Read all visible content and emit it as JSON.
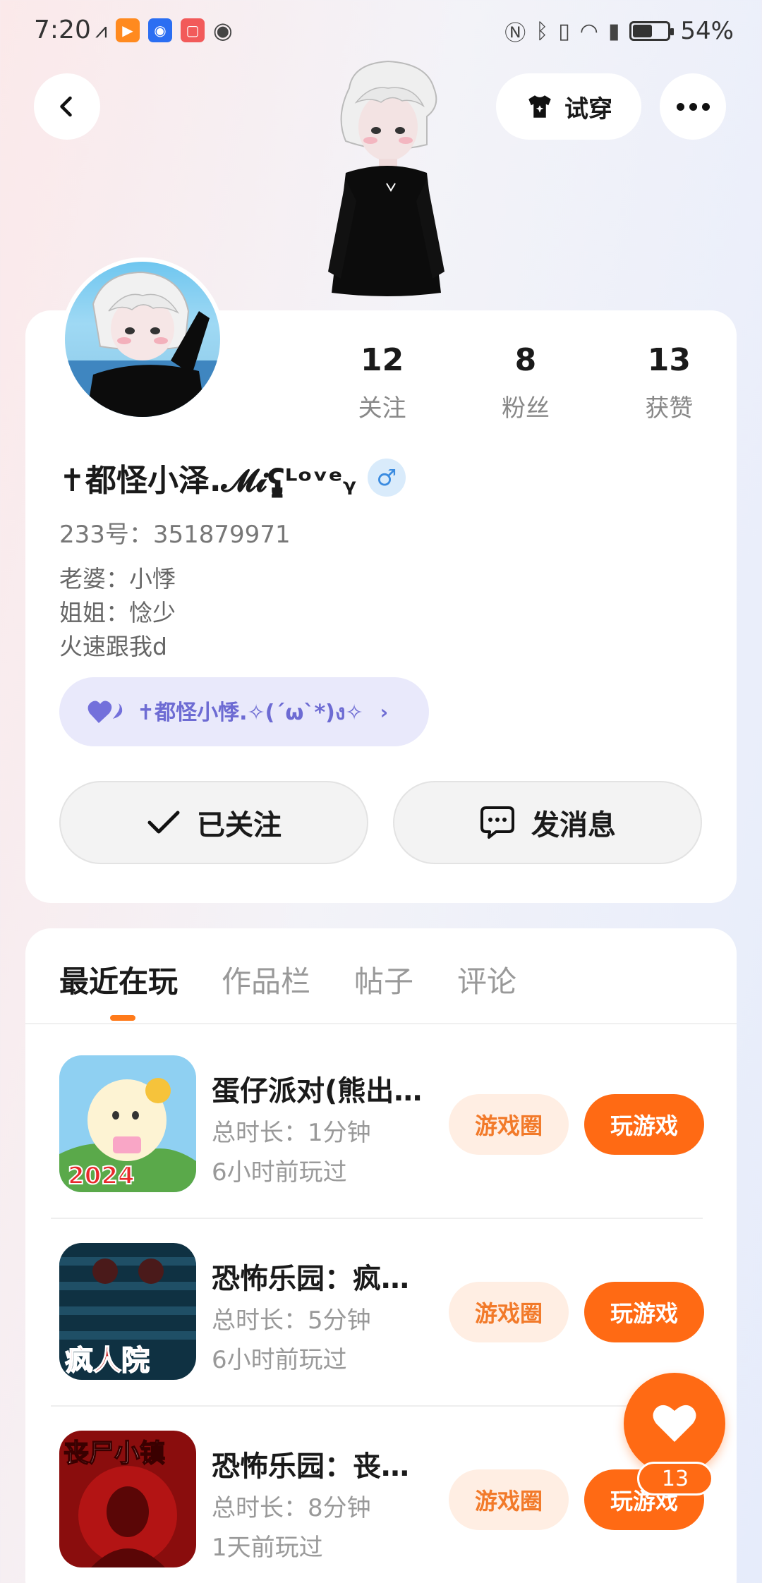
{
  "status_bar": {
    "time": "7:20",
    "battery_text": "54%",
    "battery_level": 0.54,
    "left_icons": [
      "swift-icon",
      "play-icon",
      "bulb-icon",
      "red-app-icon",
      "eye-icon"
    ],
    "right_icons": [
      "nfc-icon",
      "bluetooth-icon",
      "vibrate-icon",
      "wifi-icon",
      "sim-alert-icon",
      "battery-icon"
    ]
  },
  "header": {
    "try_on_label": "试穿",
    "colors": {
      "accent": "#ff6a14"
    }
  },
  "profile": {
    "stats": [
      {
        "value": "12",
        "label": "关注"
      },
      {
        "value": "8",
        "label": "粉丝"
      },
      {
        "value": "13",
        "label": "获赞"
      }
    ],
    "username": "✝都怪小泽.𝓜𝓲ʕ̡̢ᴸᵒᵛᵉᵧ",
    "gender_icon": "male-icon",
    "gender_symbol": "♂",
    "uid": "233号：351879971",
    "bio": [
      "老婆：小悸",
      "姐姐：惗少",
      "火速跟我d"
    ],
    "tag_text": "✝都怪小悸.✧(´ω`*)ง✧",
    "tag_chevron": "›",
    "follow_label": "已关注",
    "message_label": "发消息"
  },
  "tabs": [
    {
      "label": "最近在玩",
      "active": true
    },
    {
      "label": "作品栏",
      "active": false
    },
    {
      "label": "帖子",
      "active": false
    },
    {
      "label": "评论",
      "active": false
    }
  ],
  "games": [
    {
      "title": "蛋仔派对(熊出…",
      "playtime": "总时长：1分钟",
      "last_played": "6小时前玩过",
      "thumb_text": "2024",
      "circle_label": "游戏圈",
      "play_label": "玩游戏"
    },
    {
      "title": "恐怖乐园：疯…",
      "playtime": "总时长：5分钟",
      "last_played": "6小时前玩过",
      "thumb_text": "疯人院",
      "circle_label": "游戏圈",
      "play_label": "玩游戏"
    },
    {
      "title": "恐怖乐园：丧…",
      "playtime": "总时长：8分钟",
      "last_played": "1天前玩过",
      "thumb_text": "丧尸小镇",
      "circle_label": "游戏圈",
      "play_label": "玩游戏"
    }
  ],
  "like_fab": {
    "count": "13",
    "icon": "heart-icon"
  }
}
